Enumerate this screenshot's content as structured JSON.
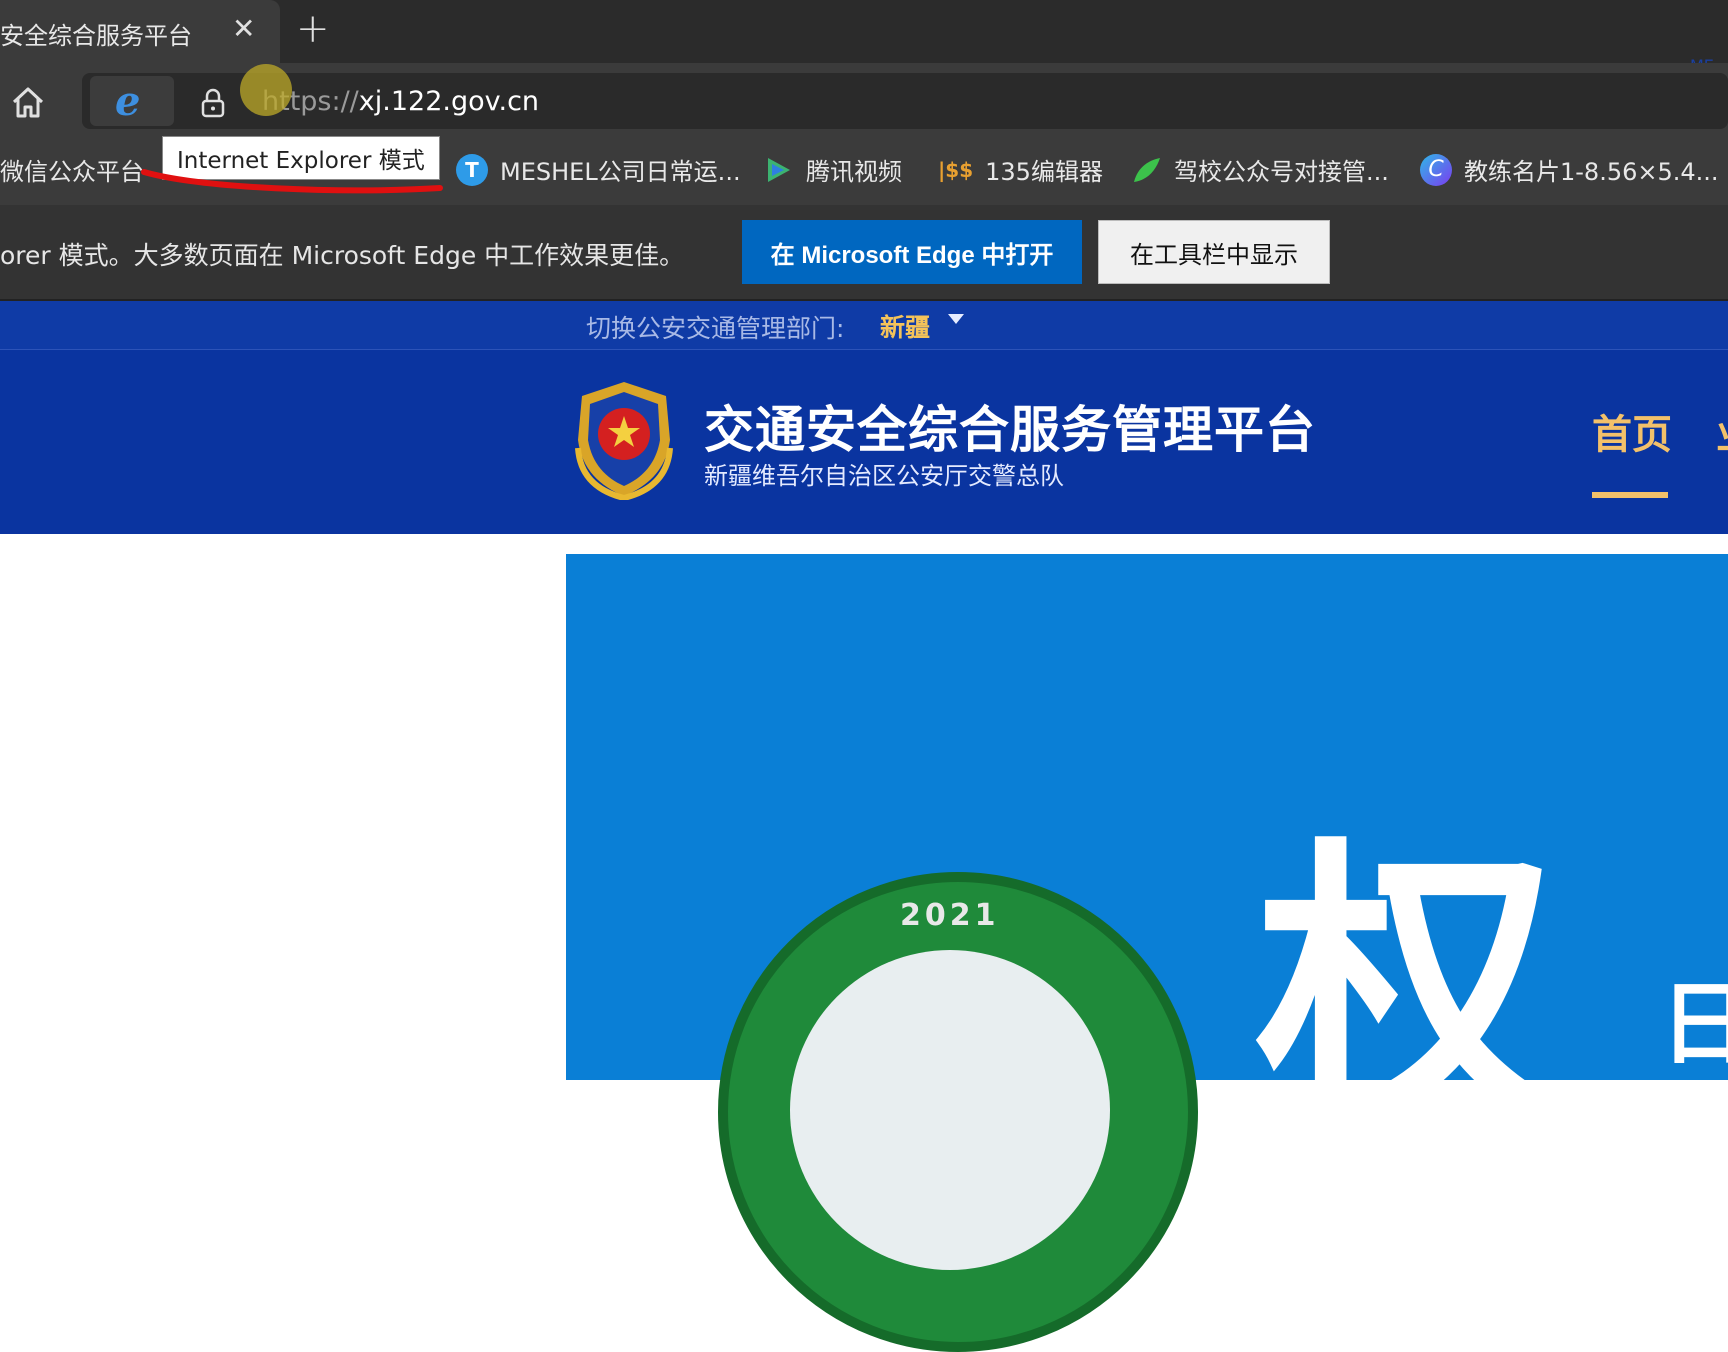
{
  "browser": {
    "tab": {
      "title": "安全综合服务平台",
      "close_glyph": "✕"
    },
    "new_tab_glyph": "+",
    "address": {
      "scheme": "https://",
      "host": "xj.122.gov.cn"
    },
    "ie_icon_glyph": "e",
    "tooltip": "Internet Explorer 模式",
    "bookmarks": [
      {
        "label": "微信公众平台",
        "icon": "wechat-icon"
      },
      {
        "label": "MESHEL公司日常运...",
        "icon": "t-logo-icon",
        "color": "#2e9be8"
      },
      {
        "label": "腾讯视频",
        "icon": "play-icon",
        "color": "#3cb371"
      },
      {
        "label": "135编辑器",
        "icon": "editor-135-icon",
        "color": "#e8a030"
      },
      {
        "label": "驾校公众号对接管...",
        "icon": "leaf-icon",
        "color": "#3cc24b"
      },
      {
        "label": "教练名片1-8.56×5.4...",
        "icon": "canva-c-icon",
        "color": "#7b3cf0"
      }
    ],
    "infobar": {
      "message": "orer 模式。大多数页面在 Microsoft Edge 中工作效果更佳。",
      "open_edge": "在 Microsoft Edge 中打开",
      "show_toolbar": "在工具栏中显示"
    },
    "corner_logo_text": "ME"
  },
  "page": {
    "dept": {
      "label": "切换公安交通管理部门:",
      "value": "新疆"
    },
    "title": "交通安全综合服务管理平台",
    "subtitle": "新疆维吾尔自治区公安厅交警总队",
    "nav": [
      {
        "label": "首页",
        "active": true
      },
      {
        "label": "业"
      }
    ],
    "banner": {
      "badge_year": "2021",
      "big_char": "权",
      "small_char": "日"
    }
  },
  "colors": {
    "header_blue": "#0a34a0",
    "nav_active": "#f3c16a",
    "edge_button": "#0067c0",
    "banner_blue": "#0a7fd6"
  }
}
